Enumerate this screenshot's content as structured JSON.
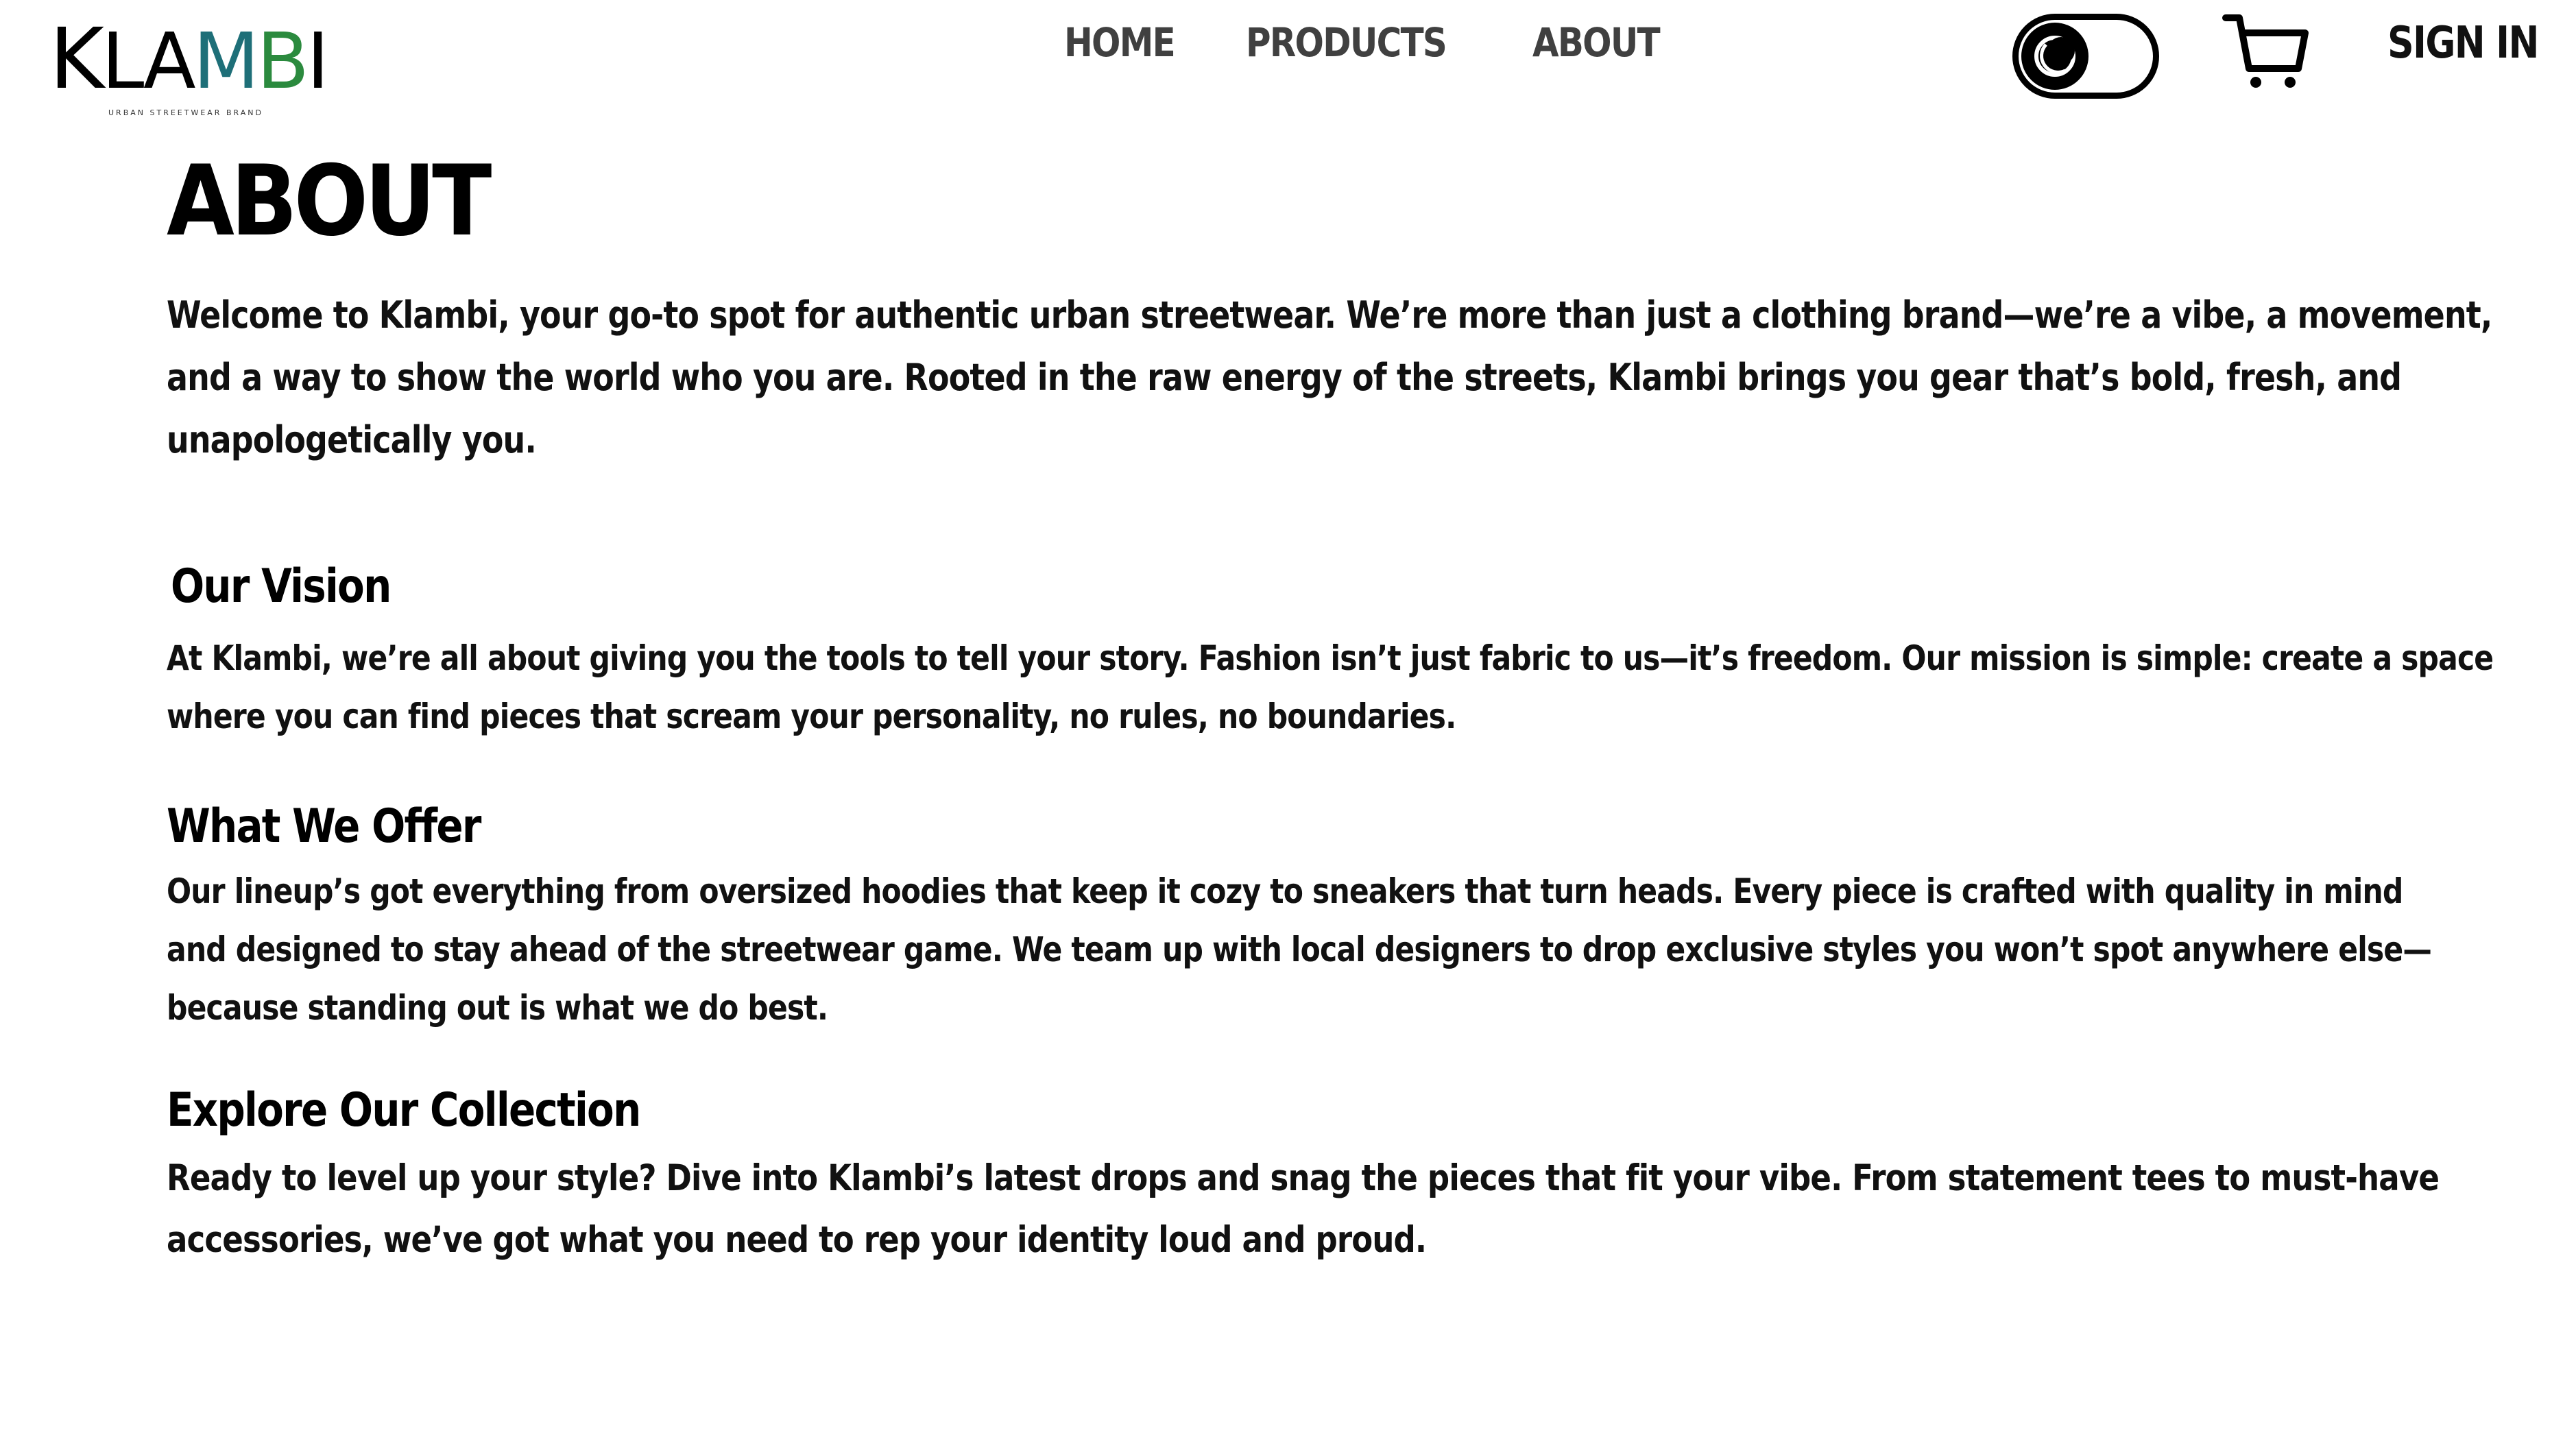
{
  "brand": {
    "name_k": "K",
    "name_la": "LA",
    "name_m": "M",
    "name_b": "B",
    "name_i": "I",
    "tagline": "URBAN STREETWEAR BRAND",
    "accent_color": "#1e6f78",
    "accent_color_2": "#2b8a3e"
  },
  "nav": {
    "items": [
      {
        "label": "HOME"
      },
      {
        "label": "PRODUCTS"
      },
      {
        "label": "ABOUT"
      }
    ],
    "color": "#404040"
  },
  "header_controls": {
    "theme_toggle_icon": "moon-icon",
    "cart_icon": "cart-icon",
    "signin_label": "SIGN IN"
  },
  "page": {
    "title": "ABOUT",
    "intro": "Welcome to Klambi, your go-to spot for authentic urban streetwear. We’re more than just a clothing brand—we’re a vibe, a movement, and a way to show the world who you are. Rooted in the raw energy of the streets, Klambi brings you gear that’s bold, fresh, and unapologetically you.",
    "sections": [
      {
        "heading": "Our Vision",
        "body": "At Klambi, we’re all about giving you the tools to tell your story. Fashion isn’t just fabric to us—it’s freedom. Our mission is simple: create a space where you can find pieces that scream your personality, no rules, no boundaries."
      },
      {
        "heading": "What We Offer",
        "body": "Our lineup’s got everything from oversized hoodies that keep it cozy to sneakers that turn heads. Every piece is crafted with quality in mind and designed to stay ahead of the streetwear game. We team up with local designers to drop exclusive styles you won’t spot anywhere else—because standing out is what we do best."
      },
      {
        "heading": "Explore Our Collection",
        "body": "Ready to level up your style? Dive into Klambi’s latest drops and snag the pieces that fit your vibe. From statement tees to must-have accessories, we’ve got what you need to rep your identity loud and proud."
      }
    ]
  }
}
